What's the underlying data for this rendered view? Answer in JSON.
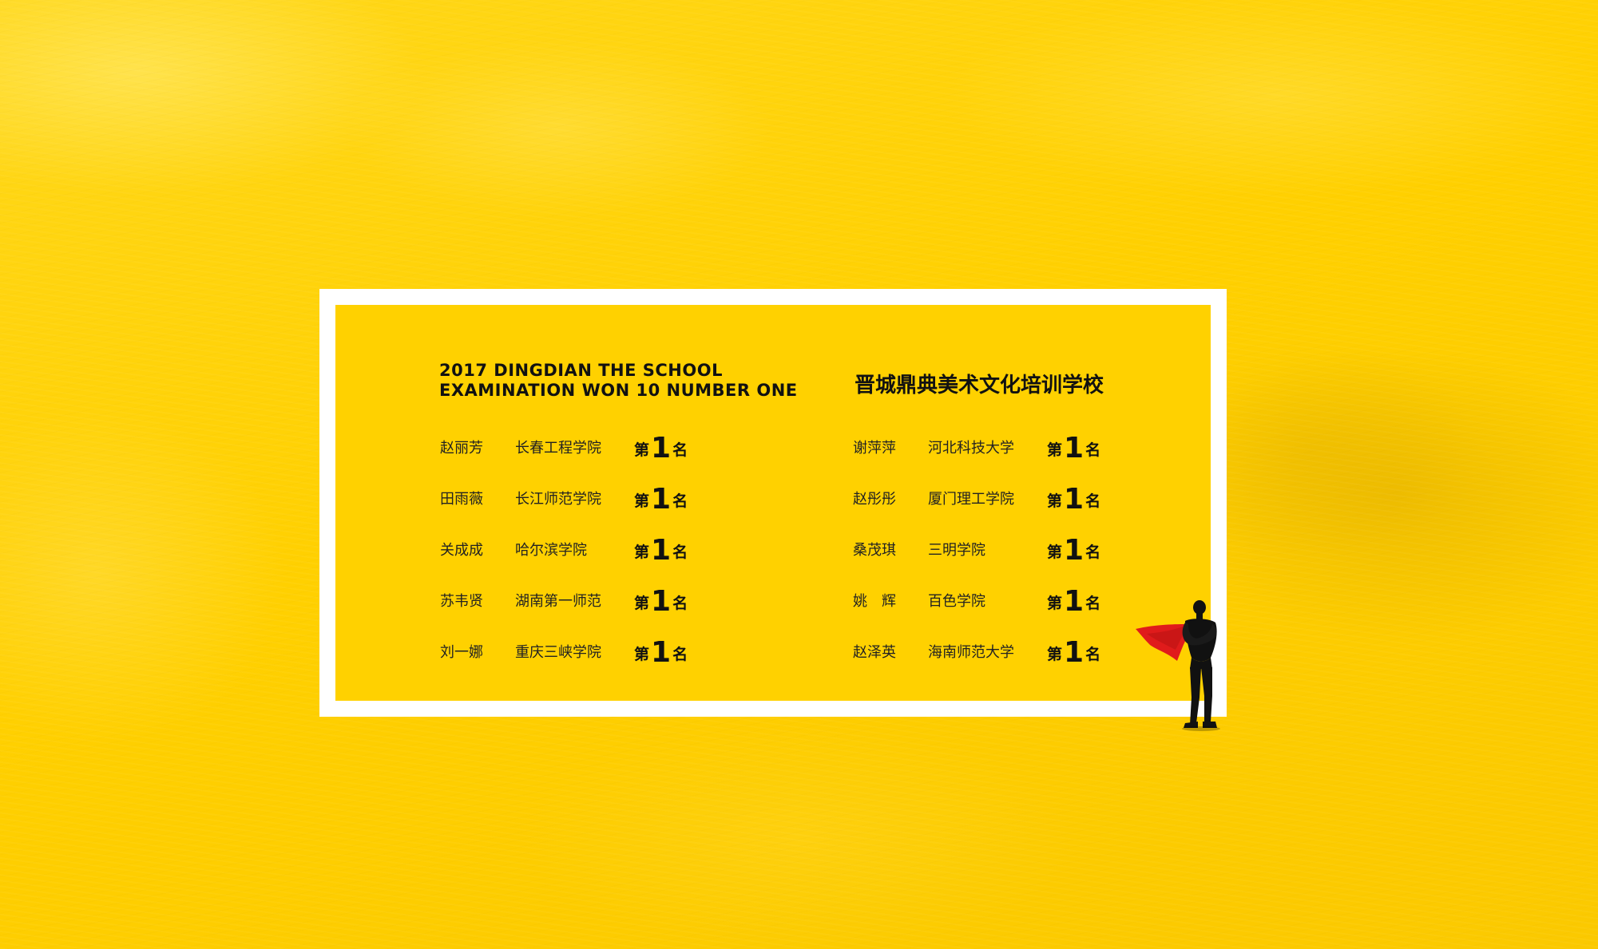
{
  "heading": {
    "english_line1": "2017 DINGDIAN THE SCHOOL",
    "english_line2": "EXAMINATION WON 10 NUMBER ONE",
    "chinese": "晋城鼎典美术文化培训学校"
  },
  "rank_label": {
    "prefix": "第",
    "number": "1",
    "suffix": "名"
  },
  "left_list": [
    {
      "name": "赵丽芳",
      "school": "长春工程学院"
    },
    {
      "name": "田雨薇",
      "school": "长江师范学院"
    },
    {
      "name": "关成成",
      "school": "哈尔滨学院"
    },
    {
      "name": "苏韦贤",
      "school": "湖南第一师范"
    },
    {
      "name": "刘一娜",
      "school": "重庆三峡学院"
    }
  ],
  "right_list": [
    {
      "name": "谢萍萍",
      "school": "河北科技大学"
    },
    {
      "name": "赵彤彤",
      "school": "厦门理工学院"
    },
    {
      "name": "桑茂琪",
      "school": "三明学院"
    },
    {
      "name": "姚　辉",
      "school": "百色学院"
    },
    {
      "name": "赵泽英",
      "school": "海南师范大学"
    }
  ],
  "colors": {
    "background": "#FFD100",
    "frame": "#FFFFFF",
    "text": "#111111",
    "cape": "#E01B1B"
  },
  "decoration": {
    "icon": "superhero-silhouette-icon"
  }
}
